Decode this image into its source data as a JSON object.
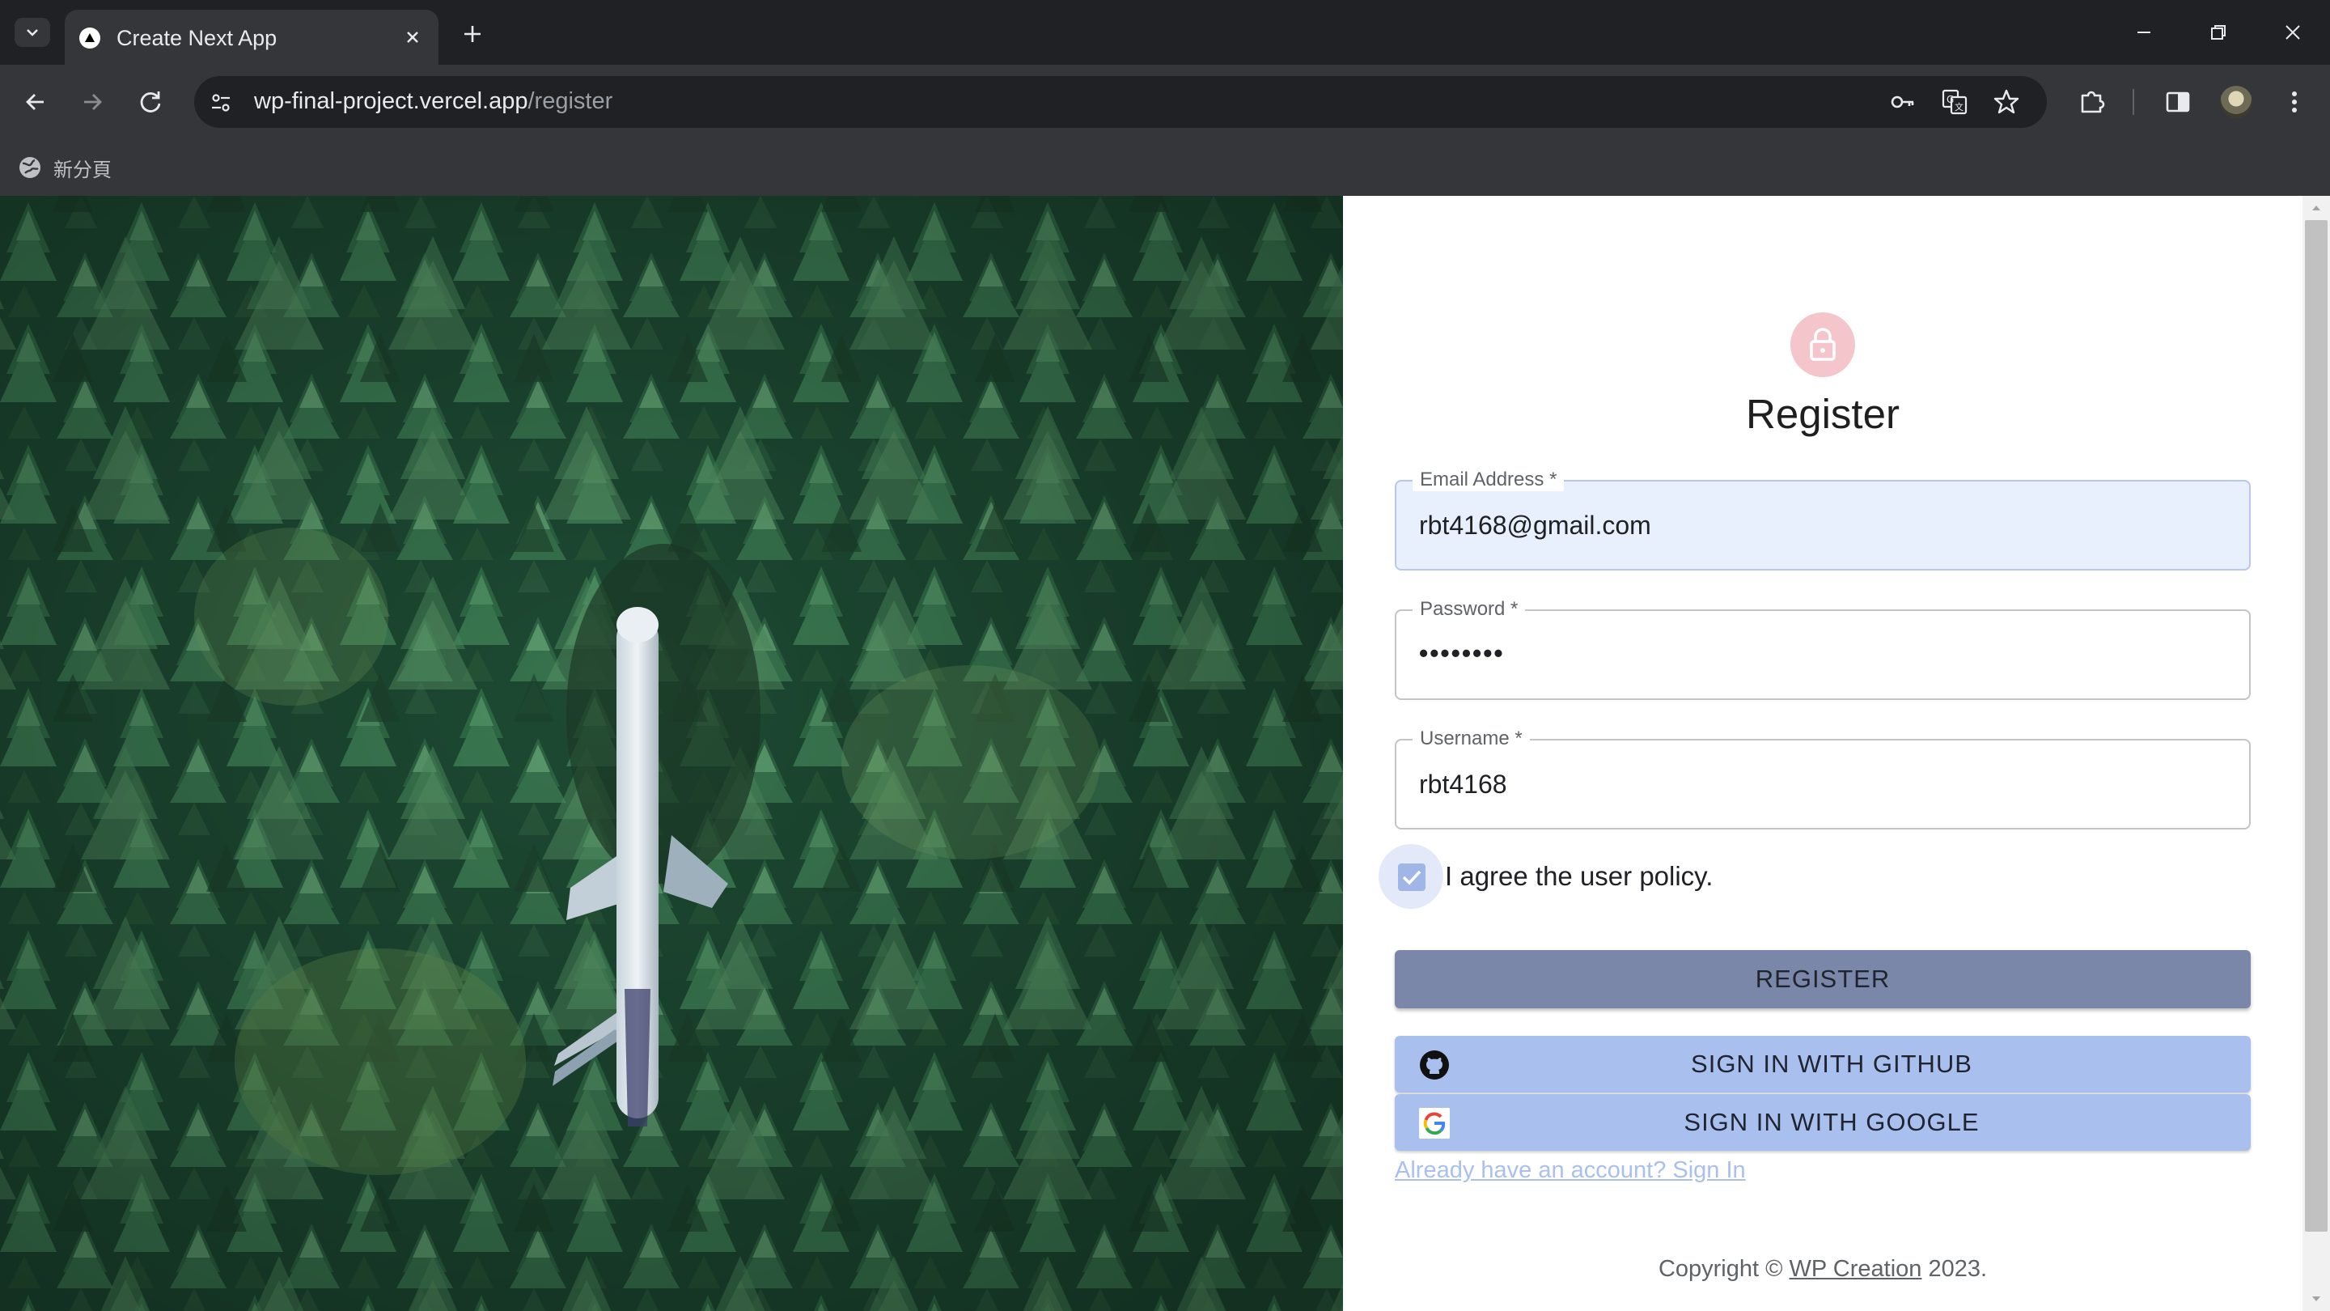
{
  "browser": {
    "tab_title": "Create Next App",
    "url_host": "wp-final-project.vercel.app",
    "url_path": "/register",
    "bookmark_label": "新分頁"
  },
  "icons": [
    "tab-search-icon",
    "nextjs-favicon-icon",
    "close-icon",
    "plus-icon",
    "minimize-icon",
    "restore-icon",
    "back-icon",
    "forward-icon",
    "reload-icon",
    "site-settings-icon",
    "key-icon",
    "translate-icon",
    "star-icon",
    "extensions-icon",
    "side-panel-icon",
    "profile-avatar",
    "more-vert-icon",
    "globe-icon",
    "lock-icon",
    "checkmark-icon",
    "github-icon",
    "google-icon"
  ],
  "hero": {
    "alt": "Aerial view of a white airplane in a dense pine forest"
  },
  "form": {
    "title": "Register",
    "email": {
      "label": "Email Address *",
      "value": "rbt4168@gmail.com"
    },
    "password": {
      "label": "Password *",
      "value": "••••••••"
    },
    "username": {
      "label": "Username *",
      "value": "rbt4168"
    },
    "agree": {
      "label": "I agree the user policy.",
      "checked": true
    },
    "register_button": "REGISTER",
    "github_button": "SIGN IN WITH GITHUB",
    "google_button": "SIGN IN WITH GOOGLE",
    "signin_link": "Already have an account? Sign In"
  },
  "footer": {
    "prefix": "Copyright © ",
    "link": "WP Creation",
    "suffix": " 2023."
  },
  "colors": {
    "accent_avatar": "#f4c6cc",
    "register_button": "#7b87a8",
    "social_button": "#a9c0ef",
    "autofill_bg": "#e8f0fe"
  }
}
